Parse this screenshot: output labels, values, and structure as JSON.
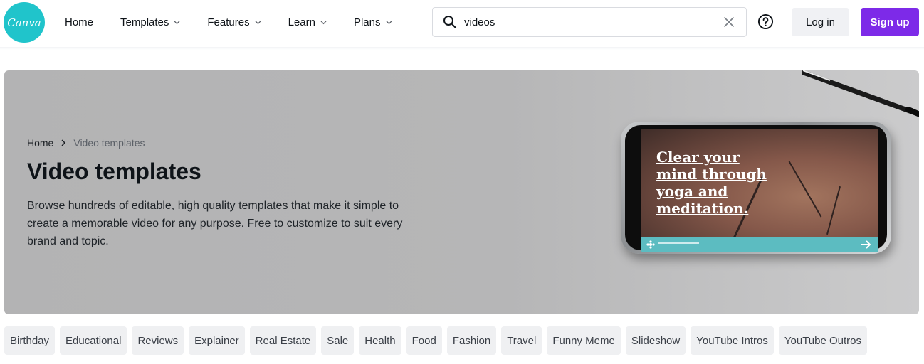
{
  "header": {
    "logo_text": "Canva",
    "nav": [
      {
        "label": "Home",
        "has_dropdown": false
      },
      {
        "label": "Templates",
        "has_dropdown": true
      },
      {
        "label": "Features",
        "has_dropdown": true
      },
      {
        "label": "Learn",
        "has_dropdown": true
      },
      {
        "label": "Plans",
        "has_dropdown": true
      }
    ],
    "search": {
      "value": "videos",
      "icon": "search-icon",
      "clear_icon": "close-icon"
    },
    "help_icon": "help-circle-icon",
    "login_label": "Log in",
    "signup_label": "Sign up"
  },
  "hero": {
    "breadcrumb": {
      "home": "Home",
      "current": "Video templates"
    },
    "title": "Video templates",
    "description": "Browse hundreds of editable, high quality templates that make it simple to create a memorable video for any purpose. Free to customize to suit every brand and topic.",
    "phone_screen": {
      "lines": [
        "Clear your",
        "mind through",
        "yoga and",
        "meditation."
      ]
    }
  },
  "categories": [
    "Birthday",
    "Educational",
    "Reviews",
    "Explainer",
    "Real Estate",
    "Sale",
    "Health",
    "Food",
    "Fashion",
    "Travel",
    "Funny Meme",
    "Slideshow",
    "YouTube Intros",
    "YouTube Outros"
  ],
  "colors": {
    "brand_teal": "#20c4cb",
    "signup_purple": "#7d2ae8",
    "chip_bg": "#eff0f2",
    "hero_bg": "#b5b5b6"
  }
}
